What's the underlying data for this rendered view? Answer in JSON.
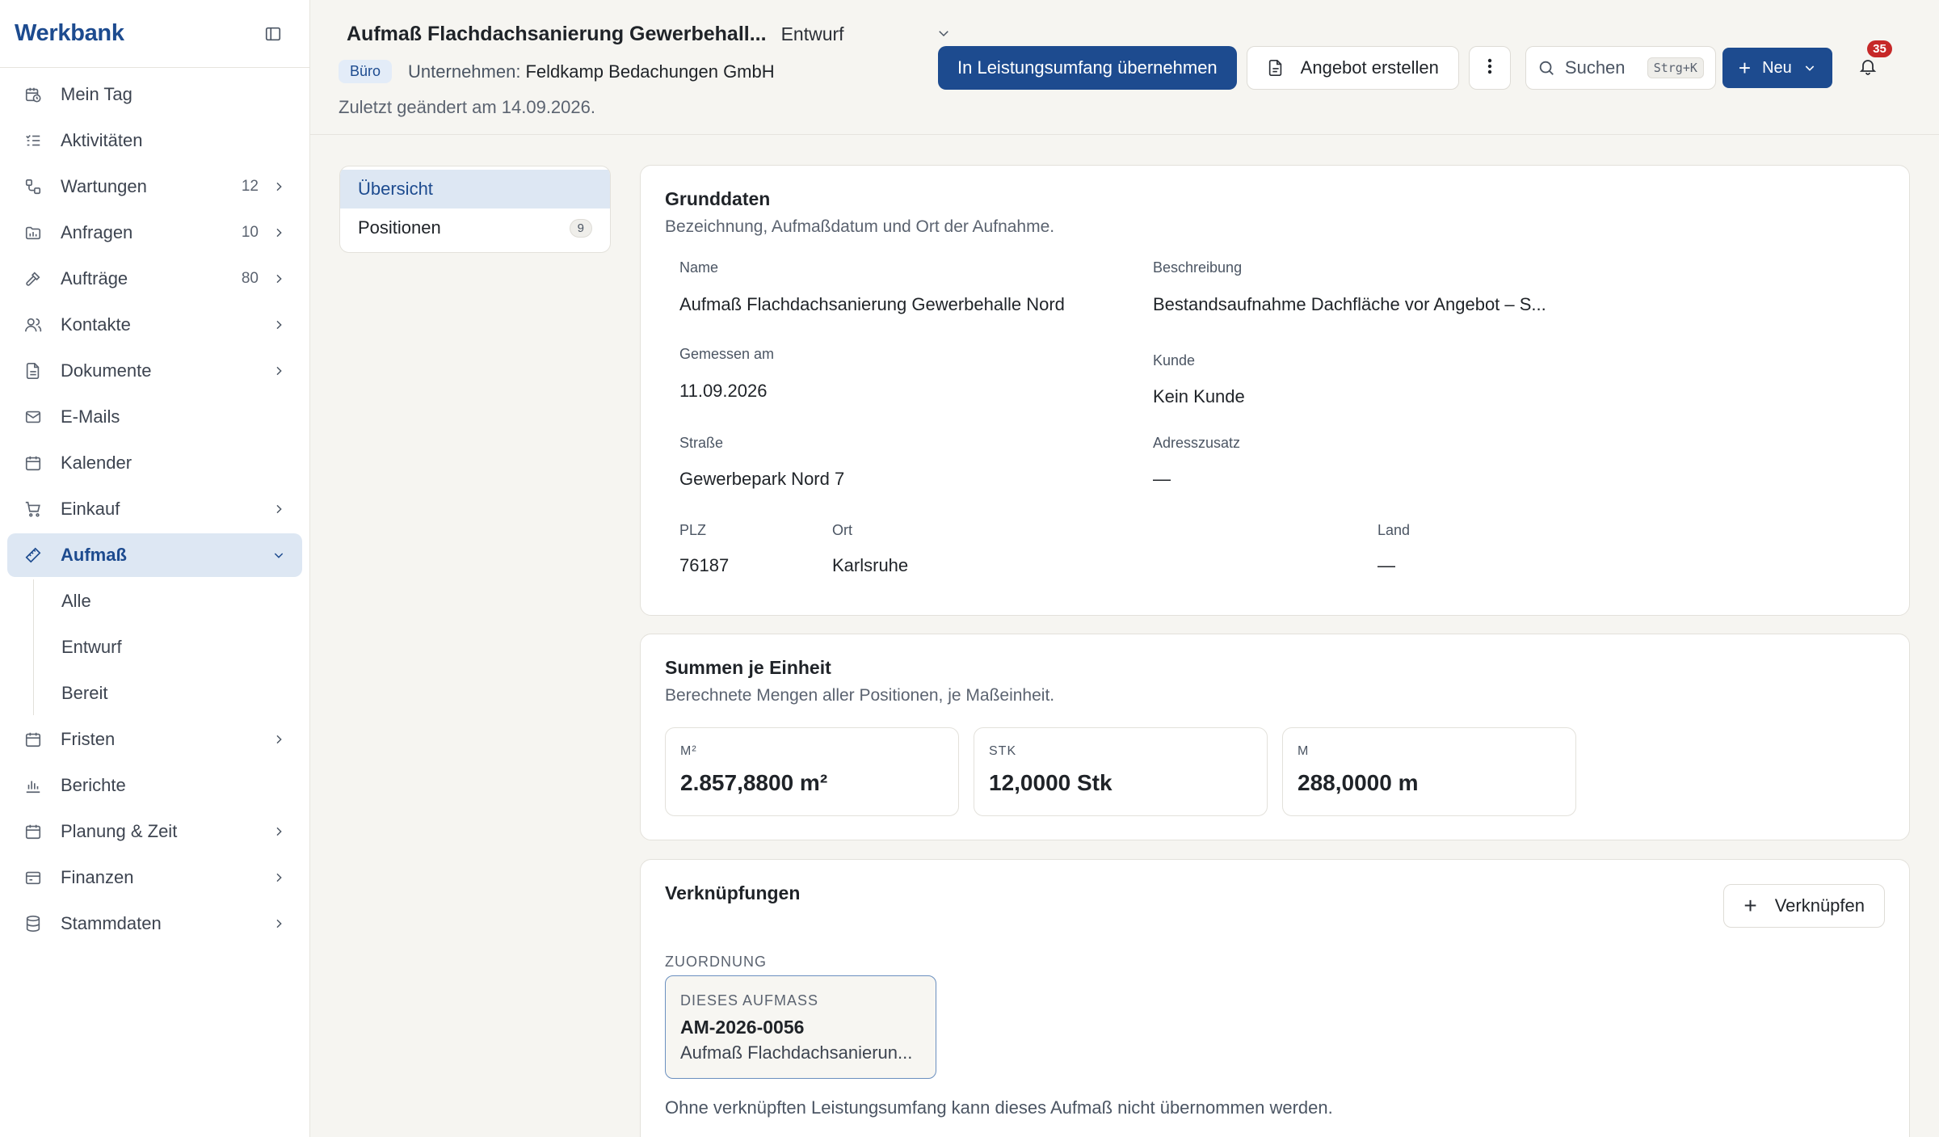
{
  "sidebar": {
    "brand": "Werkbank",
    "items": [
      {
        "label": "Mein Tag",
        "count": "",
        "chevron": false,
        "icon": "calendar-clock-icon"
      },
      {
        "label": "Aktivitäten",
        "count": "",
        "chevron": false,
        "icon": "checklist-icon"
      },
      {
        "label": "Wartungen",
        "count": "12",
        "chevron": true,
        "icon": "workflow-icon"
      },
      {
        "label": "Anfragen",
        "count": "10",
        "chevron": true,
        "icon": "folder-icon"
      },
      {
        "label": "Aufträge",
        "count": "80",
        "chevron": true,
        "icon": "hammer-icon"
      },
      {
        "label": "Kontakte",
        "count": "",
        "chevron": true,
        "icon": "users-icon"
      },
      {
        "label": "Dokumente",
        "count": "",
        "chevron": true,
        "icon": "file-icon"
      },
      {
        "label": "E-Mails",
        "count": "",
        "chevron": false,
        "icon": "mail-icon"
      },
      {
        "label": "Kalender",
        "count": "",
        "chevron": false,
        "icon": "calendar-icon"
      },
      {
        "label": "Einkauf",
        "count": "",
        "chevron": true,
        "icon": "cart-icon"
      },
      {
        "label": "Aufmaß",
        "count": "",
        "chevron": true,
        "icon": "ruler-icon"
      },
      {
        "label": "Fristen",
        "count": "",
        "chevron": true,
        "icon": "calendar-icon"
      },
      {
        "label": "Berichte",
        "count": "",
        "chevron": false,
        "icon": "bar-chart-icon"
      },
      {
        "label": "Planung & Zeit",
        "count": "",
        "chevron": true,
        "icon": "calendar-icon"
      },
      {
        "label": "Finanzen",
        "count": "",
        "chevron": true,
        "icon": "wallet-icon"
      },
      {
        "label": "Stammdaten",
        "count": "",
        "chevron": true,
        "icon": "database-icon"
      }
    ],
    "aufmass_sub": [
      "Alle",
      "Entwurf",
      "Bereit"
    ]
  },
  "header": {
    "title": "Aufmaß Flachdachsanierung Gewerbehall...",
    "status": "Entwurf",
    "badge": "Büro",
    "company_label": "Unternehmen:",
    "company_name": "Feldkamp Bedachungen GmbH",
    "changed": "Zuletzt geändert am 14.09.2026.",
    "primary_action": "In Leistungsumfang übernehmen",
    "offer_action": "Angebot erstellen",
    "search_label": "Suchen",
    "search_shortcut": "Strg+K",
    "new_label": "Neu",
    "notification_count": "35"
  },
  "tabs": [
    {
      "label": "Übersicht",
      "count": ""
    },
    {
      "label": "Positionen",
      "count": "9"
    }
  ],
  "grunddaten": {
    "title": "Grunddaten",
    "subtitle": "Bezeichnung, Aufmaßdatum und Ort der Aufnahme.",
    "name_label": "Name",
    "name_value": "Aufmaß Flachdachsanierung Gewerbehalle Nord",
    "desc_label": "Beschreibung",
    "desc_value": "Bestandsaufnahme Dachfläche vor Angebot – S...",
    "date_label": "Gemessen am",
    "date_value": "11.09.2026",
    "customer_label": "Kunde",
    "customer_value": "Kein Kunde",
    "street_label": "Straße",
    "street_value": "Gewerbepark Nord 7",
    "addr2_label": "Adresszusatz",
    "addr2_value": "—",
    "zip_label": "PLZ",
    "zip_value": "76187",
    "city_label": "Ort",
    "city_value": "Karlsruhe",
    "country_label": "Land",
    "country_value": "—"
  },
  "summen": {
    "title": "Summen je Einheit",
    "subtitle": "Berechnete Mengen aller Positionen, je Maßeinheit.",
    "boxes": [
      {
        "unit": "M²",
        "value": "2.857,8800 m²"
      },
      {
        "unit": "STK",
        "value": "12,0000 Stk"
      },
      {
        "unit": "M",
        "value": "288,0000 m"
      }
    ]
  },
  "verknuepfungen": {
    "title": "Verknüpfungen",
    "link_button": "Verknüpfen",
    "caption": "ZUORDNUNG",
    "card_caption": "DIESES AUFMASS",
    "card_code": "AM-2026-0056",
    "card_name": "Aufmaß Flachdachsanierun...",
    "hint": "Ohne verknüpften Leistungsumfang kann dieses Aufmaß nicht übernommen werden."
  }
}
